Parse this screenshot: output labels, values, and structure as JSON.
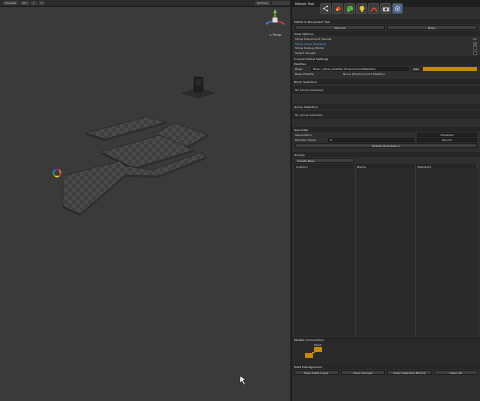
{
  "scene": {
    "toolbar": {
      "shaded_label": "Shaded",
      "mode_2d_label": "2D",
      "gizmos_label": "Gizmos"
    },
    "view_label": "< Persp"
  },
  "panel": {
    "title": "Mosaic Tool",
    "tools": [
      {
        "icon": "share-icon"
      },
      {
        "icon": "paint-bucket-icon"
      },
      {
        "icon": "palette-icon"
      },
      {
        "icon": "bulb-icon"
      },
      {
        "icon": "arch-icon"
      },
      {
        "icon": "camera-icon"
      },
      {
        "icon": "settings-icon"
      }
    ],
    "platform_title": "Platform Placement Tool",
    "platform_tabs": {
      "left": "Manual",
      "right": "Basic"
    },
    "view_options": {
      "title": "View Options",
      "items": [
        {
          "label": "Show Placement Visuals",
          "value": "On"
        },
        {
          "label": "Show Level Shadows",
          "value": "✔"
        },
        {
          "label": "Show Debug Points",
          "value": ""
        },
        {
          "label": "Select Visuals",
          "value": ""
        }
      ]
    },
    "level_settings_title": "Level Global Settings",
    "palettes": {
      "title": "Palettes",
      "rows": [
        {
          "label": "Basic",
          "value": "Basic_Cities_Palette (EnvironmentPalette)",
          "tag": "Set"
        },
        {
          "label": "Base Palette",
          "value": "None (Environment Palette)"
        }
      ]
    },
    "block_selection": {
      "title": "Block Selection",
      "message": "No blocks selected."
    },
    "group_selection": {
      "title": "Group Selection",
      "message": "No group selected."
    },
    "generate": {
      "title": "Generate",
      "rows": [
        {
          "label": "Generation",
          "value": "Disabled"
        },
        {
          "label": "Random Seed",
          "value": "0",
          "extra": "Re-roll"
        }
      ],
      "button": "Rotate Orientation"
    },
    "groups": {
      "title": "Groups",
      "create_label": "Create New",
      "columns": [
        "Custom",
        "Name",
        "Standard"
      ]
    },
    "palette_connections": {
      "title": "Palette Connections",
      "node_label": "Start"
    },
    "data_management": {
      "title": "Data Management",
      "buttons": [
        "Save Data Layer",
        "Clear Groups",
        "Clear Selected Blocks",
        "Clear All"
      ]
    }
  }
}
